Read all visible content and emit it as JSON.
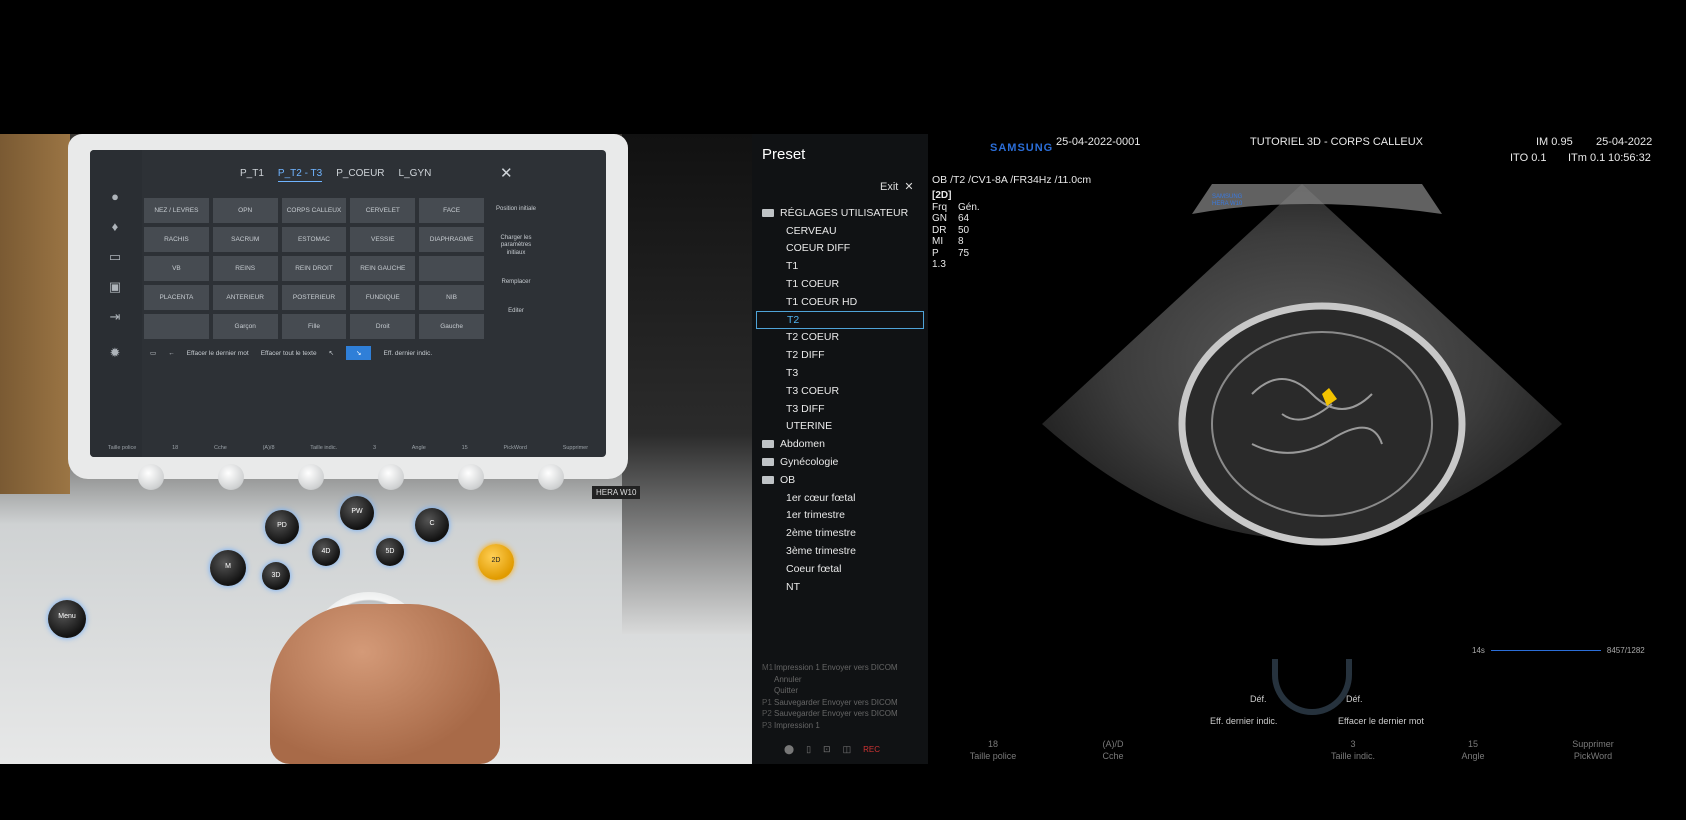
{
  "touchscreen": {
    "tabs": [
      "P_T1",
      "P_T2 - T3",
      "P_COEUR",
      "L_GYN"
    ],
    "active_tab": 1,
    "grid": [
      "NEZ / LEVRES",
      "OPN",
      "CORPS CALLEUX",
      "CERVELET",
      "FACE",
      "RACHIS",
      "SACRUM",
      "ESTOMAC",
      "VESSIE",
      "DIAPHRAGME",
      "VB",
      "REINS",
      "REIN DROIT",
      "REIN GAUCHE",
      "",
      "PLACENTA",
      "ANTERIEUR",
      "POSTERIEUR",
      "FUNDIQUE",
      "NIB",
      "",
      "Garçon",
      "Fille",
      "Droit",
      "Gauche"
    ],
    "right_buttons": [
      "Position initiale",
      "Charger les paramètres initiaux",
      "Remplacer",
      "Editer"
    ],
    "keys": [
      "←",
      "Effacer le dernier mot",
      "Effacer tout le texte",
      "Eff. dernier indic."
    ],
    "bottom": [
      "Taille police",
      "18",
      "Cche",
      "(A)/8",
      "Taille indic.",
      "3",
      "Angle",
      "15",
      "PickWord",
      "Supprimer"
    ]
  },
  "console": {
    "keys": [
      "PD",
      "PW",
      "C",
      "M",
      "3D",
      "4D",
      "5D",
      "2D",
      "Menu"
    ],
    "model_label": "HERA W10"
  },
  "preset": {
    "title": "Preset",
    "exit_label": "Exit",
    "tree": [
      {
        "label": "RÉGLAGES UTILISATEUR",
        "type": "folder"
      },
      {
        "label": "CERVEAU",
        "type": "item"
      },
      {
        "label": "COEUR DIFF",
        "type": "item"
      },
      {
        "label": "T1",
        "type": "item"
      },
      {
        "label": "T1 COEUR",
        "type": "item"
      },
      {
        "label": "T1 COEUR HD",
        "type": "item"
      },
      {
        "label": "T2",
        "type": "item",
        "selected": true
      },
      {
        "label": "T2 COEUR",
        "type": "item"
      },
      {
        "label": "T2 DIFF",
        "type": "item"
      },
      {
        "label": "T3",
        "type": "item"
      },
      {
        "label": "T3 COEUR",
        "type": "item"
      },
      {
        "label": "T3 DIFF",
        "type": "item"
      },
      {
        "label": "UTERINE",
        "type": "item"
      },
      {
        "label": "Abdomen",
        "type": "folder"
      },
      {
        "label": "Gynécologie",
        "type": "folder"
      },
      {
        "label": "OB",
        "type": "folder"
      },
      {
        "label": "1er cœur fœtal",
        "type": "item"
      },
      {
        "label": "1er trimestre",
        "type": "item"
      },
      {
        "label": "2ème trimestre",
        "type": "item"
      },
      {
        "label": "3ème trimestre",
        "type": "item"
      },
      {
        "label": "Coeur fœtal",
        "type": "item"
      },
      {
        "label": "NT",
        "type": "item"
      }
    ],
    "commands": [
      {
        "k": "M1",
        "t": "Impression 1   Envoyer vers DICOM"
      },
      {
        "k": "",
        "t": "Annuler"
      },
      {
        "k": "",
        "t": "Quitter"
      },
      {
        "k": "P1",
        "t": "Sauvegarder   Envoyer vers DICOM"
      },
      {
        "k": "P2",
        "t": "Sauvegarder   Envoyer vers DICOM"
      },
      {
        "k": "P3",
        "t": "Impression 1"
      }
    ],
    "rec_label": "REC"
  },
  "header": {
    "brand": "SAMSUNG",
    "patient_id": "25-04-2022-0001",
    "study": "TUTORIEL 3D - CORPS CALLEUX",
    "im": "IM 0.95",
    "date": "25-04-2022",
    "ito": "ITO 0.1",
    "itm": "ITm 0.1",
    "time": "10:56:32"
  },
  "probe": "OB /T2 /CV1-8A /FR34Hz /11.0cm",
  "params": {
    "mode": "[2D]",
    "rows": [
      [
        "Frq",
        "Gén."
      ],
      [
        "GN",
        "64"
      ],
      [
        "DR",
        "50"
      ],
      [
        "MI",
        "8"
      ],
      [
        "P",
        "75"
      ],
      [
        "1.3",
        ""
      ]
    ]
  },
  "image_watermark": "SAMSUNG HERA W10",
  "cine": {
    "left": "14s",
    "right": "8457/1282"
  },
  "knob": {
    "l1": "Déf.",
    "r1": "Déf.",
    "l2": "Eff. dernier indic.",
    "r2": "Effacer le dernier mot"
  },
  "footer": [
    {
      "top": "18",
      "bottom": "Taille police"
    },
    {
      "top": "(A)/D",
      "bottom": "Cche"
    },
    {
      "top": "3",
      "bottom": "Taille indic."
    },
    {
      "top": "15",
      "bottom": "Angle"
    },
    {
      "top": "Supprimer",
      "bottom": "PickWord"
    }
  ],
  "colors": {
    "selected": "#4fb3f0",
    "brand": "#2b6ed8",
    "cursor": "#f2c200"
  }
}
